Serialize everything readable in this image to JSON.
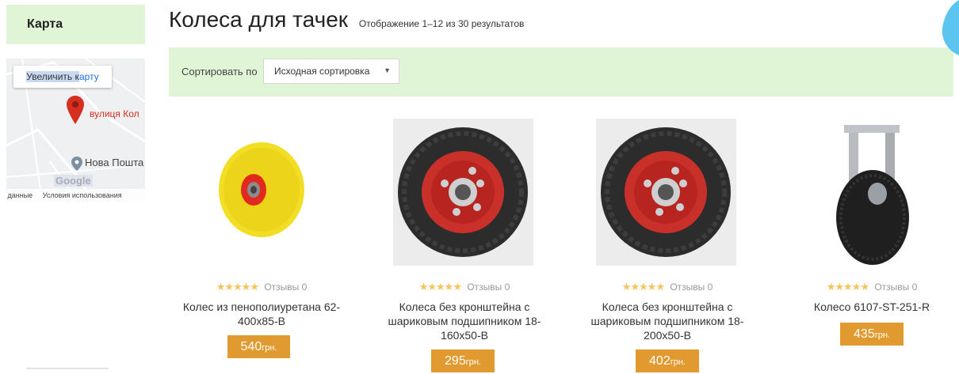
{
  "sidebar": {
    "heading": "Карта",
    "map": {
      "enlarge_selected": "Увеличить к",
      "enlarge_link": "арту",
      "street_label": "вулиця Кол",
      "poi_label": "Нова Пошта",
      "google_label": "Google",
      "footer_left": "е данные",
      "footer_right": "Условия использования"
    }
  },
  "main": {
    "title": "Колеса для тачек",
    "result_count": "Отображение 1–12 из 30 результатов",
    "sort": {
      "label": "Сортировать по",
      "selected": "Исходная сортировка"
    }
  },
  "products": [
    {
      "stars": "★★★★★",
      "reviews": "Отзывы 0",
      "name": "Колес из пенополиуретана 62-400x85-B",
      "price": "540",
      "currency": "грн.",
      "rating": 0
    },
    {
      "stars": "★★★★★",
      "reviews": "Отзывы 0",
      "name": "Колеса без кронштейна с шариковым подшипником 18-160х50-В",
      "price": "295",
      "currency": "грн.",
      "rating": 0
    },
    {
      "stars": "★★★★★",
      "reviews": "Отзывы 0",
      "name": "Колеса без кронштейна с шариковым подшипником 18-200х50-В",
      "price": "402",
      "currency": "грн.",
      "rating": 0
    },
    {
      "stars": "★★★★★",
      "reviews": "Отзывы 0",
      "name": "Колесо 6107-ST-251-R",
      "price": "435",
      "currency": "грн.",
      "rating": 0
    }
  ],
  "colors": {
    "accent_green": "#dff5d6",
    "price_orange": "#e19a30",
    "star_gold": "#f3c55c",
    "pin_red": "#d62f20"
  },
  "icons": [
    "map-pin-icon",
    "map-poi-icon",
    "dropdown-arrow-icon",
    "star-icon"
  ]
}
